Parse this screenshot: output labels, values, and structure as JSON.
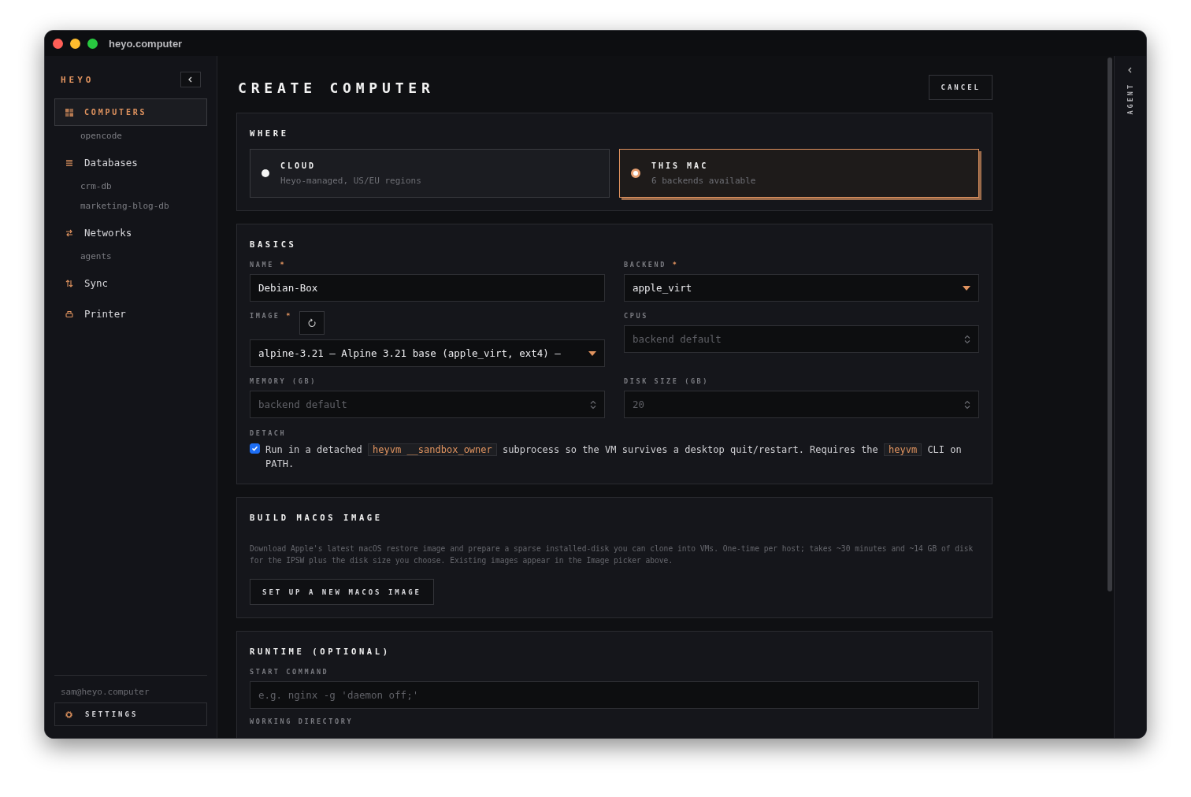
{
  "window": {
    "title": "heyo.computer"
  },
  "sidebar": {
    "logo": "HEYO",
    "items": [
      {
        "label": "COMPUTERS",
        "selected": true,
        "children": [
          {
            "label": "opencode",
            "selected": false
          }
        ]
      },
      {
        "label": "Databases",
        "selected": false,
        "children": [
          {
            "label": "crm-db",
            "selected": false
          },
          {
            "label": "marketing-blog-db",
            "selected": false
          }
        ]
      },
      {
        "label": "Networks",
        "selected": false,
        "children": [
          {
            "label": "agents",
            "selected": false
          }
        ]
      },
      {
        "label": "Sync",
        "selected": false
      },
      {
        "label": "Printer",
        "selected": false
      }
    ],
    "user": "sam@heyo.computer",
    "settings_button": "SETTINGS"
  },
  "page": {
    "title": "CREATE COMPUTER",
    "cancel_button": "CANCEL"
  },
  "sections": [
    {
      "kind": "options",
      "title": "WHERE",
      "options": [
        {
          "label": "CLOUD",
          "description": "Heyo-managed, US/EU regions",
          "selected": false
        },
        {
          "label": "THIS MAC",
          "description": "6 backends available",
          "selected": true
        }
      ]
    },
    {
      "kind": "form",
      "title": "BASICS",
      "fields": [
        {
          "label": "NAME",
          "marker": "*",
          "kind": "text",
          "value": "Debian-Box"
        },
        {
          "label": "BACKEND",
          "marker": "*",
          "kind": "select",
          "value": "apple_virt"
        },
        {
          "label": "IMAGE",
          "marker": "*",
          "kind": "select",
          "value": "alpine-3.21 — Alpine 3.21 base (apple_virt, ext4) —",
          "refresh_button": true
        },
        {
          "label": "CPUS",
          "kind": "number",
          "placeholder": "backend default"
        },
        {
          "label": "MEMORY (GB)",
          "kind": "number",
          "placeholder": "backend default"
        },
        {
          "label": "DISK SIZE (GB)",
          "kind": "number",
          "placeholder": "20"
        }
      ],
      "checkbox": {
        "label": "DETACH",
        "checked": true,
        "text": [
          {
            "kind": "plain",
            "text": "Run in a detached "
          },
          {
            "kind": "code",
            "text": "heyvm __sandbox_owner"
          },
          {
            "kind": "plain",
            "text": " subprocess so the VM survives a desktop quit/restart. Requires the "
          },
          {
            "kind": "code",
            "text": "heyvm"
          },
          {
            "kind": "plain",
            "text": " CLI on PATH."
          }
        ]
      }
    },
    {
      "kind": "info",
      "title": "BUILD MACOS IMAGE",
      "description": "Download Apple's latest macOS restore image and prepare a sparse installed-disk you can clone into VMs. One-time per host; takes ~30 minutes and ~14 GB of disk for the IPSW plus the disk size you choose. Existing images appear in the Image picker above.",
      "button": "SET UP A NEW MACOS IMAGE"
    },
    {
      "kind": "wide_form",
      "title": "RUNTIME (OPTIONAL)",
      "fields": [
        {
          "label": "START COMMAND",
          "kind": "text",
          "placeholder": "e.g. nginx -g 'daemon off;'"
        },
        {
          "label": "WORKING DIRECTORY",
          "kind": "hidden"
        }
      ]
    }
  ],
  "agent_panel": {
    "label": "AGENT"
  }
}
